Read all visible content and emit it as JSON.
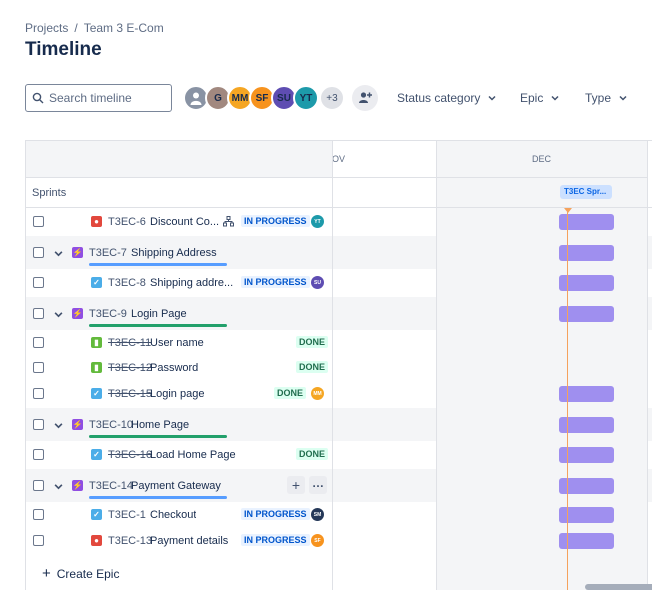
{
  "breadcrumb": {
    "projects": "Projects",
    "separator": "/",
    "project": "Team 3 E-Com"
  },
  "page_title": "Timeline",
  "search": {
    "placeholder": "Search timeline",
    "icon": "search-icon"
  },
  "avatars": [
    {
      "initials": "",
      "color": "#8993a4",
      "kind": "default-user"
    },
    {
      "initials": "G",
      "color": "#a1887f"
    },
    {
      "initials": "MM",
      "color": "#f5a623"
    },
    {
      "initials": "SF",
      "color": "#f7931e"
    },
    {
      "initials": "SU",
      "color": "#5e4db2"
    },
    {
      "initials": "YT",
      "color": "#1d9aaa"
    }
  ],
  "avatars_more": "+3",
  "filters": {
    "status_category": "Status category",
    "epic": "Epic",
    "type": "Type"
  },
  "timeline": {
    "months": [
      "OV",
      "DEC"
    ],
    "sprints_label": "Sprints",
    "sprint_chip": "T3EC Spr...",
    "rows": [
      {
        "type": "bug",
        "key": "T3EC-6",
        "summary": "Discount Co...",
        "status": "IN PROGRESS",
        "assignee": "YT",
        "assignee_color": "#1d9aaa",
        "has_child_icon": true,
        "bar": true
      },
      {
        "type": "epic",
        "key": "T3EC-7",
        "summary": "Shipping Address",
        "progress_color": "#579dff",
        "bar": true
      },
      {
        "type": "task",
        "key": "T3EC-8",
        "summary": "Shipping addre...",
        "status": "IN PROGRESS",
        "assignee": "SU",
        "assignee_color": "#5e4db2",
        "bar": true
      },
      {
        "type": "epic",
        "key": "T3EC-9",
        "summary": "Login Page",
        "progress_color": "#22a06b",
        "bar": true
      },
      {
        "type": "story",
        "key": "T3EC-11",
        "summary": "User name",
        "status": "DONE",
        "done": true,
        "bar": false
      },
      {
        "type": "story",
        "key": "T3EC-12",
        "summary": "Password",
        "status": "DONE",
        "done": true,
        "bar": false
      },
      {
        "type": "task",
        "key": "T3EC-15",
        "summary": "Login page",
        "status": "DONE",
        "done": true,
        "assignee": "MM",
        "assignee_color": "#f5a623",
        "bar": true
      },
      {
        "type": "epic",
        "key": "T3EC-10",
        "summary": "Home Page",
        "progress_color": "#22a06b",
        "bar": true
      },
      {
        "type": "task",
        "key": "T3EC-16",
        "summary": "Load Home Page",
        "status": "DONE",
        "done": true,
        "bar": true
      },
      {
        "type": "epic",
        "key": "T3EC-14",
        "summary": "Payment Gateway",
        "progress_color": "#579dff",
        "bar": true,
        "hover_actions": true
      },
      {
        "type": "task",
        "key": "T3EC-1",
        "summary": "Checkout",
        "status": "IN PROGRESS",
        "assignee": "SM",
        "assignee_color": "#253858",
        "bar": true
      },
      {
        "type": "bug",
        "key": "T3EC-13",
        "summary": "Payment details",
        "status": "IN PROGRESS",
        "assignee": "SF",
        "assignee_color": "#f7931e",
        "bar": true
      }
    ],
    "create_epic": "Create Epic"
  }
}
